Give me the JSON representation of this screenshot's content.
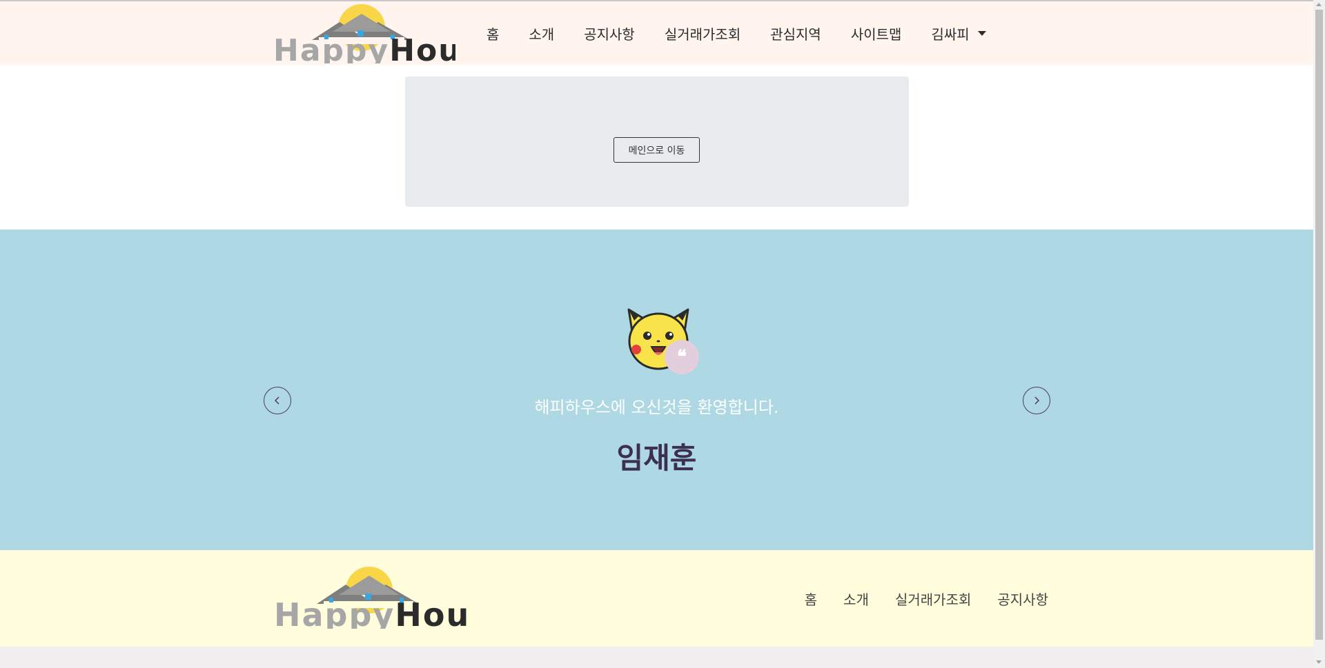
{
  "brand": {
    "name_part1": "Happy",
    "name_part2": "House"
  },
  "header": {
    "nav": [
      {
        "label": "홈"
      },
      {
        "label": "소개"
      },
      {
        "label": "공지사항"
      },
      {
        "label": "실거래가조회"
      },
      {
        "label": "관심지역"
      },
      {
        "label": "사이트맵"
      }
    ],
    "user_menu_label": "김싸피"
  },
  "main": {
    "go_main_button": "메인으로 이동"
  },
  "testimonial": {
    "message": "해피하우스에 오신것을 환영합니다.",
    "name": "임재훈",
    "quote_mark": "❝"
  },
  "footer": {
    "nav": [
      {
        "label": "홈"
      },
      {
        "label": "소개"
      },
      {
        "label": "실거래가조회"
      },
      {
        "label": "공지사항"
      }
    ]
  },
  "colors": {
    "header_bg": "#fff4ee",
    "testimonial_bg": "#add8e4",
    "footer_bg": "#fffddc",
    "name_color": "#3d2f4f",
    "logo_gray": "#a6a6a6",
    "logo_dark": "#2b2b2b",
    "sun": "#f9d648"
  }
}
